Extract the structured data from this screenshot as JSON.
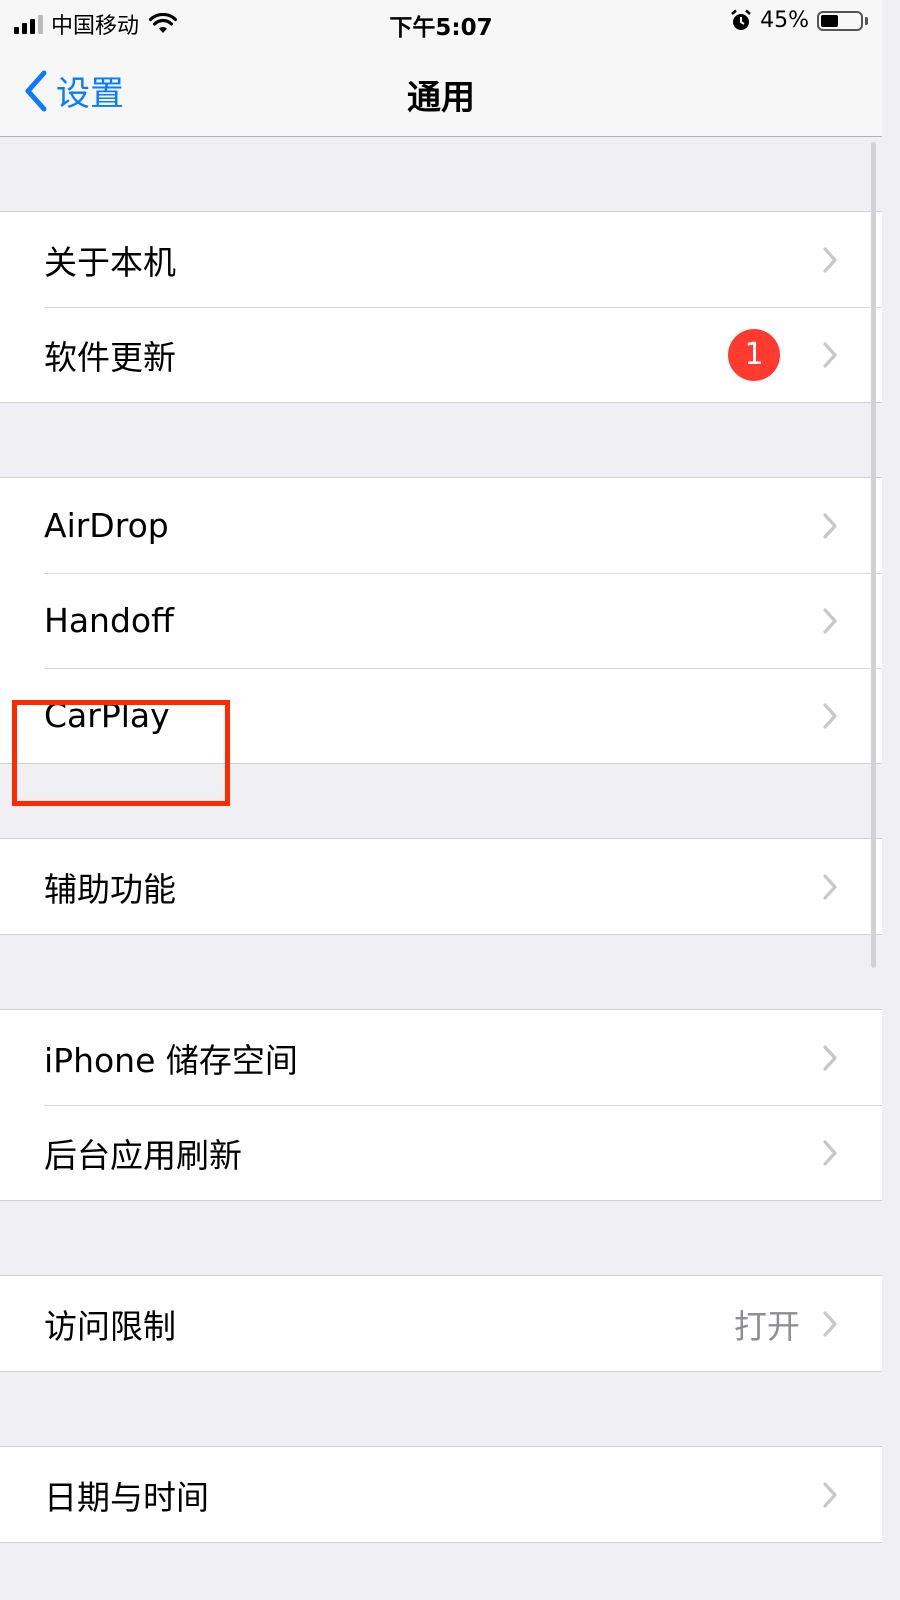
{
  "status_bar": {
    "carrier": "中国移动",
    "time": "下午5:07",
    "battery_percent_label": "45%",
    "battery_level": 0.45,
    "signal_bars": 3
  },
  "nav": {
    "back_label": "设置",
    "title": "通用"
  },
  "groups": [
    {
      "rows": [
        {
          "label": "关于本机"
        },
        {
          "label": "软件更新",
          "badge": "1"
        }
      ]
    },
    {
      "rows": [
        {
          "label": "AirDrop"
        },
        {
          "label": "Handoff"
        },
        {
          "label": "CarPlay"
        }
      ]
    },
    {
      "rows": [
        {
          "label": "辅助功能",
          "highlighted": true
        }
      ]
    },
    {
      "rows": [
        {
          "label": "iPhone 储存空间"
        },
        {
          "label": "后台应用刷新"
        }
      ]
    },
    {
      "rows": [
        {
          "label": "访问限制",
          "value": "打开"
        }
      ]
    },
    {
      "rows": [
        {
          "label": "日期与时间"
        }
      ]
    }
  ],
  "colors": {
    "accent": "#0a7aff",
    "badge": "#ff3b30",
    "highlight_box": "#ff2a00",
    "background": "#efeff4"
  }
}
